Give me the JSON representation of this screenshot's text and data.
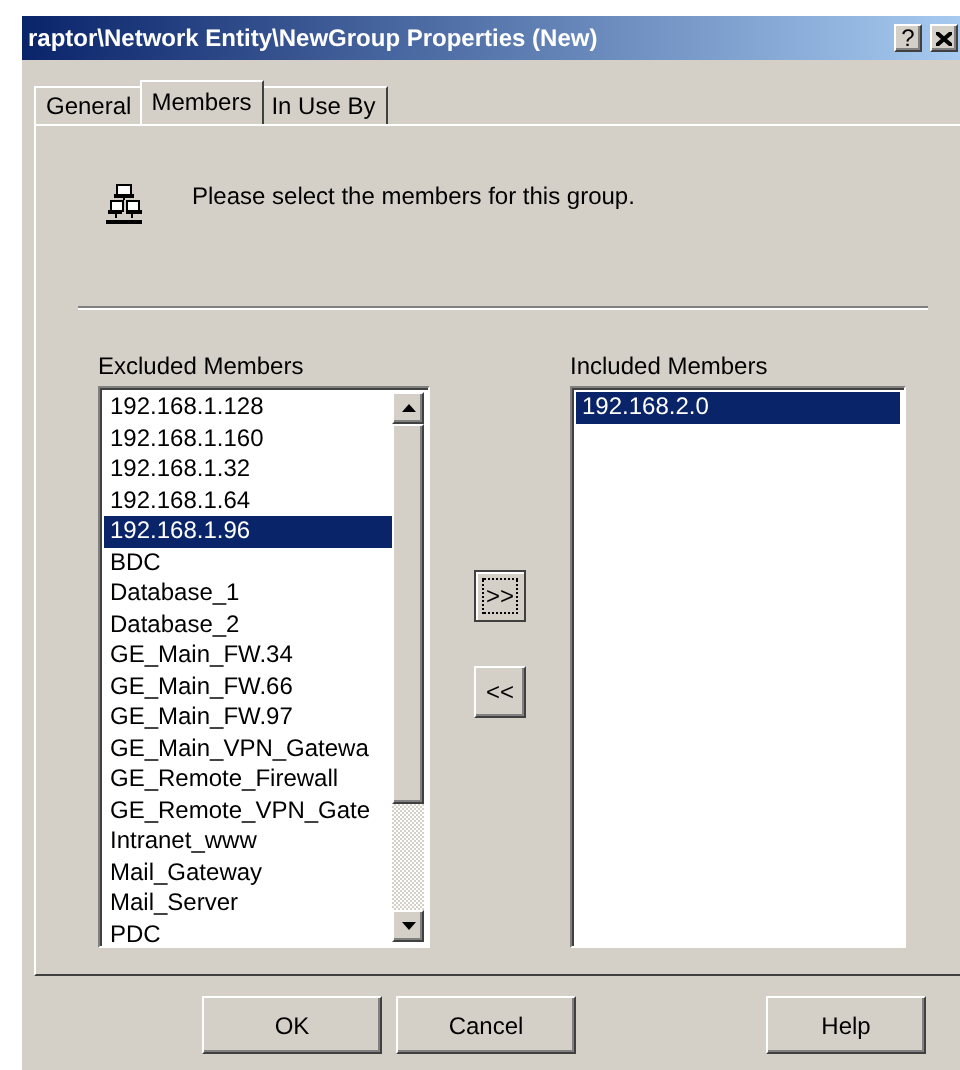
{
  "window": {
    "title": "raptor\\Network Entity\\NewGroup Properties (New)",
    "help_button": "?"
  },
  "tabs": [
    {
      "label": "General",
      "selected": false
    },
    {
      "label": "Members",
      "selected": true
    },
    {
      "label": "In Use By",
      "selected": false
    }
  ],
  "instruction": "Please select the members for this group.",
  "excluded": {
    "label": "Excluded Members",
    "items": [
      {
        "text": "192.168.1.128",
        "selected": false
      },
      {
        "text": "192.168.1.160",
        "selected": false
      },
      {
        "text": "192.168.1.32",
        "selected": false
      },
      {
        "text": "192.168.1.64",
        "selected": false
      },
      {
        "text": "192.168.1.96",
        "selected": true
      },
      {
        "text": "BDC",
        "selected": false
      },
      {
        "text": "Database_1",
        "selected": false
      },
      {
        "text": "Database_2",
        "selected": false
      },
      {
        "text": "GE_Main_FW.34",
        "selected": false
      },
      {
        "text": "GE_Main_FW.66",
        "selected": false
      },
      {
        "text": "GE_Main_FW.97",
        "selected": false
      },
      {
        "text": "GE_Main_VPN_Gatewa",
        "selected": false
      },
      {
        "text": "GE_Remote_Firewall",
        "selected": false
      },
      {
        "text": "GE_Remote_VPN_Gate",
        "selected": false
      },
      {
        "text": "Intranet_www",
        "selected": false
      },
      {
        "text": "Mail_Gateway",
        "selected": false
      },
      {
        "text": "Mail_Server",
        "selected": false
      },
      {
        "text": "PDC",
        "selected": false
      }
    ]
  },
  "move_buttons": [
    {
      "label": ">>",
      "focused": true
    },
    {
      "label": "<<",
      "focused": false
    }
  ],
  "included": {
    "label": "Included Members",
    "items": [
      {
        "text": "192.168.2.0",
        "selected": true
      }
    ]
  },
  "buttons": [
    "OK",
    "Cancel",
    "Help"
  ]
}
